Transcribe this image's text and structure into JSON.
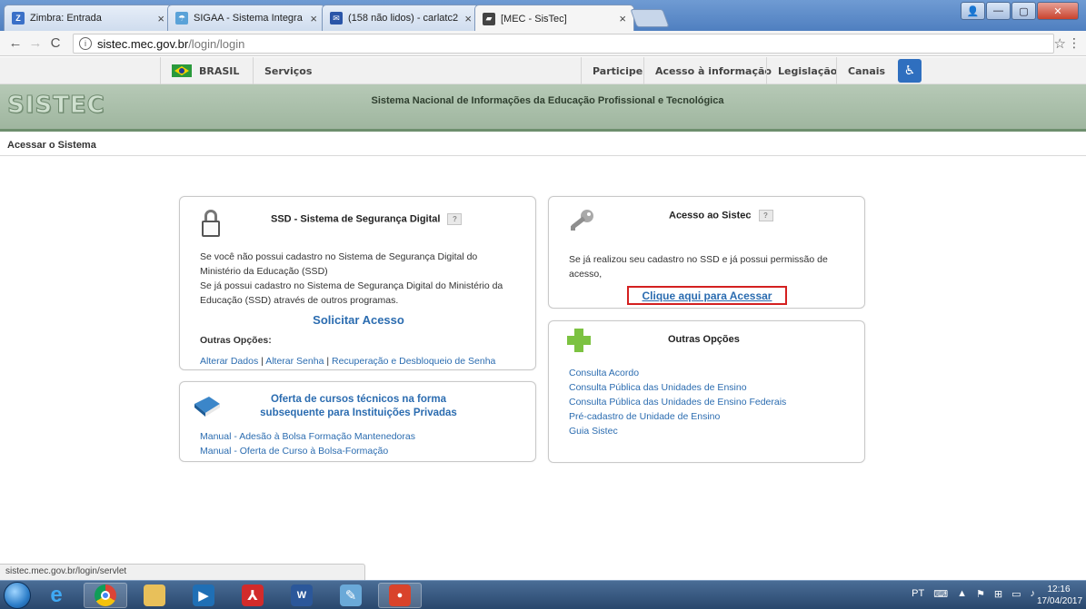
{
  "browser": {
    "tabs": [
      {
        "title": "Zimbra: Entrada",
        "icon": "zimbra-icon",
        "color": "#3a70c8",
        "glyph": "Z"
      },
      {
        "title": "SIGAA - Sistema Integra",
        "icon": "sigaa-icon",
        "color": "#5aa2d8",
        "glyph": "☂"
      },
      {
        "title": "(158 não lidos) - carlatc2",
        "icon": "mail-icon",
        "color": "#2a55a8",
        "glyph": "✉"
      },
      {
        "title": "[MEC - SisTec]",
        "icon": "mec-icon",
        "color": "#444444",
        "glyph": "▰"
      }
    ],
    "address_host": "sistec.mec.gov.br",
    "address_path": "/login/login",
    "status_url": "sistec.mec.gov.br/login/servlet"
  },
  "gov_bar": {
    "brasil": "BRASIL",
    "servicos": "Serviços",
    "participe": "Participe",
    "acesso_informacao": "Acesso à informação",
    "legislacao": "Legislação",
    "canais": "Canais"
  },
  "header": {
    "logo": "SISTEC",
    "subtitle": "Sistema Nacional de Informações da Educação Profissional e Tecnológica"
  },
  "breadcrumb": "Acessar o Sistema",
  "ssd_panel": {
    "title": "SSD - Sistema de Segurança Digital",
    "help": "?",
    "line1": "Se você não possui cadastro no Sistema de Segurança Digital do",
    "line2": "Ministério da Educação (SSD)",
    "line3": "Se já possui cadastro no Sistema de Segurança Digital do Ministério da",
    "line4": "Educação (SSD) através de outros programas.",
    "request_link": "Solicitar Acesso",
    "other_options_label": "Outras Opções:",
    "link_alterar_dados": "Alterar Dados",
    "link_alterar_senha": "Alterar Senha",
    "link_recuperacao": "Recuperação e Desbloqueio de Senha",
    "separator": "|"
  },
  "oferta_panel": {
    "title_line1": "Oferta de cursos técnicos na forma",
    "title_line2": "subsequente para Instituições Privadas",
    "link1": "Manual - Adesão à Bolsa Formação Mantenedoras",
    "link2": "Manual - Oferta de Curso à Bolsa-Formação"
  },
  "acesso_panel": {
    "title": "Acesso ao Sistec",
    "help": "?",
    "line1": "Se já realizou seu cadastro no SSD e já possui permissão de",
    "line2": "acesso,",
    "access_link": "Clique aqui para Acessar"
  },
  "outras_panel": {
    "title": "Outras Opções",
    "links": [
      "Consulta Acordo",
      "Consulta Pública das Unidades de Ensino",
      "Consulta Pública das Unidades de Ensino Federais",
      "Pré-cadastro de Unidade de Ensino",
      "Guia Sistec"
    ]
  },
  "taskbar": {
    "language": "PT",
    "time": "12:16",
    "date": "17/04/2017"
  }
}
